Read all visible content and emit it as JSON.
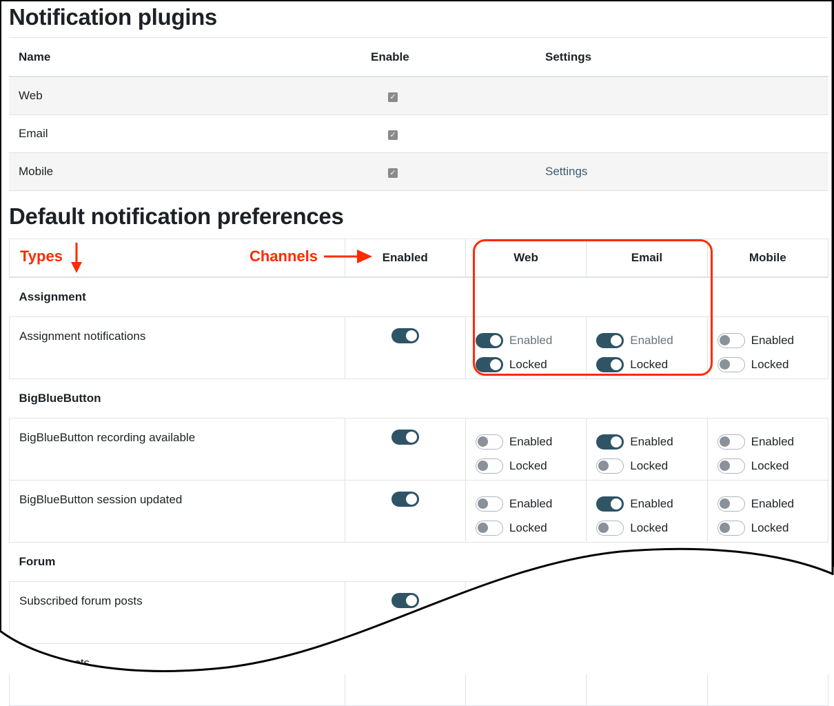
{
  "plugins": {
    "title": "Notification plugins",
    "columns": [
      "Name",
      "Enable",
      "Settings"
    ],
    "rows": [
      {
        "name": "Web",
        "enabled": true,
        "settings": ""
      },
      {
        "name": "Email",
        "enabled": true,
        "settings": ""
      },
      {
        "name": "Mobile",
        "enabled": true,
        "settings": "Settings"
      }
    ]
  },
  "defaults": {
    "title": "Default notification preferences",
    "columns": [
      "Enabled",
      "Web",
      "Email",
      "Mobile"
    ],
    "option_labels": {
      "enabled": "Enabled",
      "locked": "Locked"
    },
    "groups": [
      {
        "name": "Assignment",
        "items": [
          {
            "name": "Assignment notifications",
            "enabled": true,
            "web": {
              "enabled": true,
              "locked": true
            },
            "email": {
              "enabled": true,
              "locked": true
            },
            "mobile": {
              "enabled": false,
              "locked": false
            }
          }
        ]
      },
      {
        "name": "BigBlueButton",
        "items": [
          {
            "name": "BigBlueButton recording available",
            "enabled": true,
            "web": {
              "enabled": false,
              "locked": false
            },
            "email": {
              "enabled": true,
              "locked": false
            },
            "mobile": {
              "enabled": false,
              "locked": false
            }
          },
          {
            "name": "BigBlueButton session updated",
            "enabled": true,
            "web": {
              "enabled": false,
              "locked": false
            },
            "email": {
              "enabled": true,
              "locked": false
            },
            "mobile": {
              "enabled": false,
              "locked": false
            }
          }
        ]
      },
      {
        "name": "Forum",
        "items": [
          {
            "name": "Subscribed forum posts",
            "enabled": true
          },
          {
            "name": "forum digests"
          }
        ]
      }
    ]
  },
  "annotations": {
    "types": "Types",
    "channels": "Channels",
    "color": "#ff2a00"
  }
}
